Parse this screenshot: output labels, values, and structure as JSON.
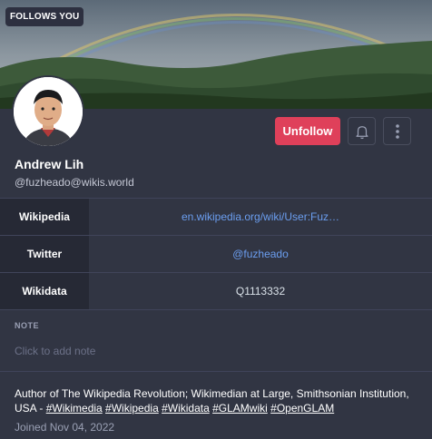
{
  "badge": {
    "follows_you": "FOLLOWS YOU"
  },
  "profile": {
    "display_name": "Andrew Lih",
    "handle": "@fuzheado@wikis.world",
    "unfollow_label": "Unfollow",
    "bell_icon": "bell-icon",
    "more_icon": "more-vertical-icon"
  },
  "fields": [
    {
      "name": "Wikipedia",
      "value": "en.wikipedia.org/wiki/User:Fuz…"
    },
    {
      "name": "Twitter",
      "value": "@fuzheado"
    },
    {
      "name": "Wikidata",
      "value": "Q1113332"
    }
  ],
  "note": {
    "label": "NOTE",
    "placeholder": "Click to add note"
  },
  "bio": {
    "text": "Author of The Wikipedia Revolution; Wikimedian at Large, Smithsonian Institution, USA -",
    "hashtags": [
      "#Wikimedia",
      "#Wikipedia",
      "#Wikidata",
      "#GLAMwiki",
      "#OpenGLAM"
    ]
  },
  "joined": "Joined Nov 04, 2022",
  "colors": {
    "background": "#313543",
    "accent": "#df405a",
    "link": "#6b9ef0"
  }
}
